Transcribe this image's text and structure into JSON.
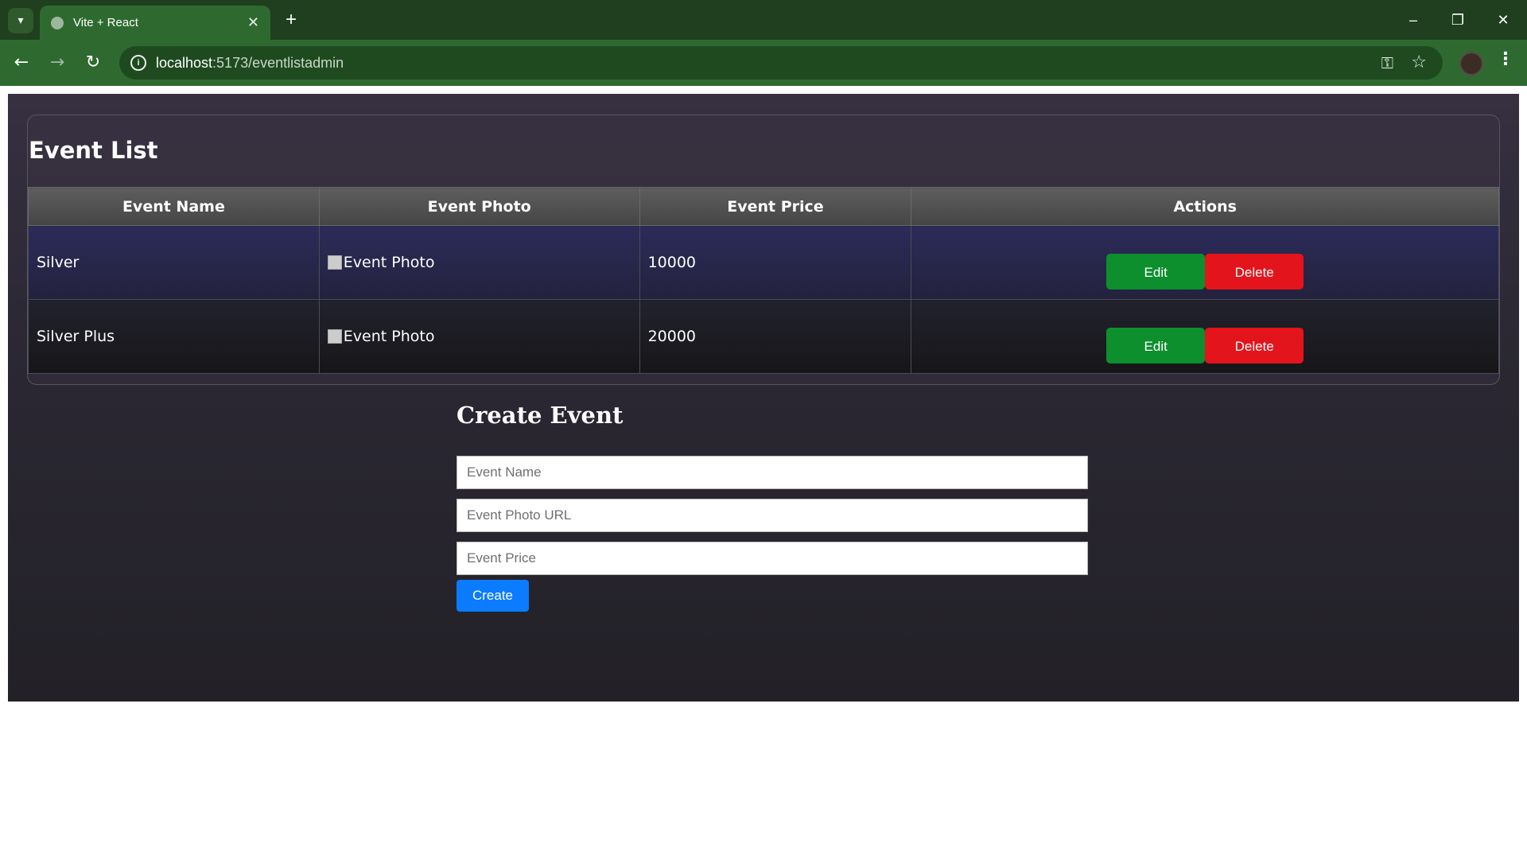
{
  "browser": {
    "tab_title": "Vite + React",
    "tab_close": "✕",
    "new_tab": "+",
    "url_host": "localhost",
    "url_rest": ":5173/eventlistadmin",
    "window_controls": {
      "minimize": "–",
      "restore": "❐",
      "close": "✕"
    }
  },
  "page": {
    "list_title": "Event List",
    "table": {
      "headers": [
        "Event Name",
        "Event Photo",
        "Event Price",
        "Actions"
      ],
      "rows": [
        {
          "name": "Silver",
          "photo_alt": "Event Photo",
          "price": "10000",
          "edit": "Edit",
          "delete": "Delete"
        },
        {
          "name": "Silver Plus",
          "photo_alt": "Event Photo",
          "price": "20000",
          "edit": "Edit",
          "delete": "Delete"
        }
      ]
    },
    "create": {
      "title": "Create Event",
      "name_placeholder": "Event Name",
      "photo_placeholder": "Event Photo URL",
      "price_placeholder": "Event Price",
      "button": "Create"
    }
  },
  "colors": {
    "chrome_dark": "#1f3f1f",
    "chrome_green": "#2e6a30",
    "edit_button": "#0d8f2e",
    "delete_button": "#e4141c",
    "create_button": "#0b7bff"
  }
}
